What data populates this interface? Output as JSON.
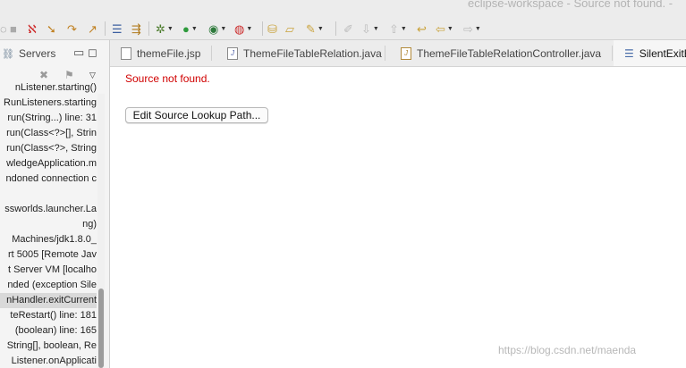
{
  "window": {
    "title": "eclipse-workspace - Source not found. -"
  },
  "toolbar": {
    "icons": [
      "skip-breakpoints-icon",
      "terminate-icon",
      "step-into-icon",
      "step-over-icon",
      "step-return-icon",
      "drop-to-frame-icon",
      "use-step-filters-icon",
      "debug-icon",
      "run-icon",
      "coverage-icon",
      "external-tools-icon",
      "open-folder-icon",
      "open-type-icon",
      "search-icon",
      "annotation-icon",
      "back-icon",
      "forward-icon"
    ],
    "colors": {
      "run": "#2e9a3c",
      "terminate": "#cc2b2b",
      "debug": "#4a7a2a"
    }
  },
  "left_panel": {
    "tab_label": "Servers",
    "stack_items": [
      "nListener.starting()",
      "RunListeners.starting",
      "run(String...) line: 31",
      "run(Class<?>[], Strin",
      "run(Class<?>, String",
      "wledgeApplication.m",
      "ndoned connection c",
      "",
      "ssworlds.launcher.La",
      "ng)",
      "Machines/jdk1.8.0_",
      "rt 5005 [Remote Jav",
      "t Server VM [localho",
      "nded (exception Sile",
      "nHandler.exitCurrent",
      "teRestart() line: 181",
      "(boolean) line: 165",
      "String[], boolean, Re",
      "Listener.onApplicati"
    ],
    "selected_index": 14
  },
  "editor": {
    "tabs": [
      {
        "label": "themeFile.jsp",
        "icon": "jsp-file-icon"
      },
      {
        "label": "ThemeFileTableRelation.java",
        "icon": "java-file-icon"
      },
      {
        "label": "ThemeFileTableRelationController.java",
        "icon": "java-file-icon"
      },
      {
        "label": "SilentExitE",
        "icon": "class-file-icon"
      }
    ],
    "active_tab": 3,
    "message": "Source not found.",
    "button_label": "Edit Source Lookup Path..."
  },
  "watermark": "https://blog.csdn.net/maenda"
}
